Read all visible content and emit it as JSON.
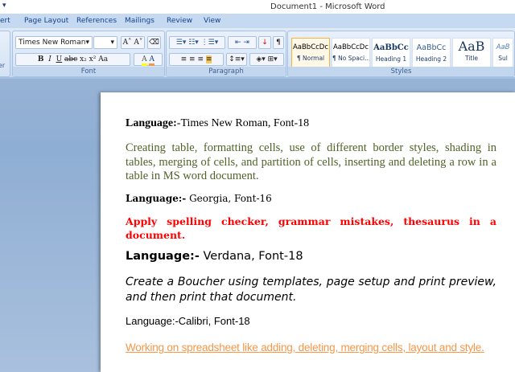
{
  "window": {
    "title": "Document1 - Microsoft Word",
    "quick_access": "▾"
  },
  "tabs": [
    "ert",
    "Page Layout",
    "References",
    "Mailings",
    "Review",
    "View"
  ],
  "ribbon": {
    "clipboard_label": "er",
    "font": {
      "name": "Times New Roman",
      "size": "",
      "label": "Font",
      "buttons": [
        "B",
        "I",
        "U",
        "abc",
        "x₂",
        "x²",
        "Aa",
        "A",
        "A"
      ]
    },
    "paragraph": {
      "label": "Paragraph"
    },
    "styles": {
      "label": "Styles",
      "items": [
        {
          "sample": "AaBbCcDc",
          "name": "¶ Normal"
        },
        {
          "sample": "AaBbCcDc",
          "name": "¶ No Spaci..."
        },
        {
          "sample": "AaBbCc",
          "name": "Heading 1"
        },
        {
          "sample": "AaBbCc",
          "name": "Heading 2"
        },
        {
          "sample": "AaB",
          "name": "Title"
        },
        {
          "sample": "AaB",
          "name": "Sul"
        }
      ]
    }
  },
  "document": {
    "l1_label": "Language:",
    "l1_value": "-Times New Roman, Font-18",
    "p1": "Creating table, formatting cells, use of different border styles, shading in tables, merging of cells, and partition of cells, inserting and deleting a row in a table in MS word document.",
    "l2_label": "Language:-",
    "l2_value": " Georgia, Font-16",
    "p2": "Apply spelling checker, grammar mistakes, thesaurus in a document.",
    "l3_label": "Language:-",
    "l3_value": " Verdana, Font-18",
    "p3": "Create a Boucher using templates, page setup and print preview, and then print that document.",
    "l4": "Language:-Calibri, Font-18",
    "p4": "Working on spreadsheet like adding, deleting, merging cells, layout and style.",
    "colors": {
      "p1": "#4f6228",
      "p2": "#ff0000",
      "p4": "#f79646"
    }
  }
}
